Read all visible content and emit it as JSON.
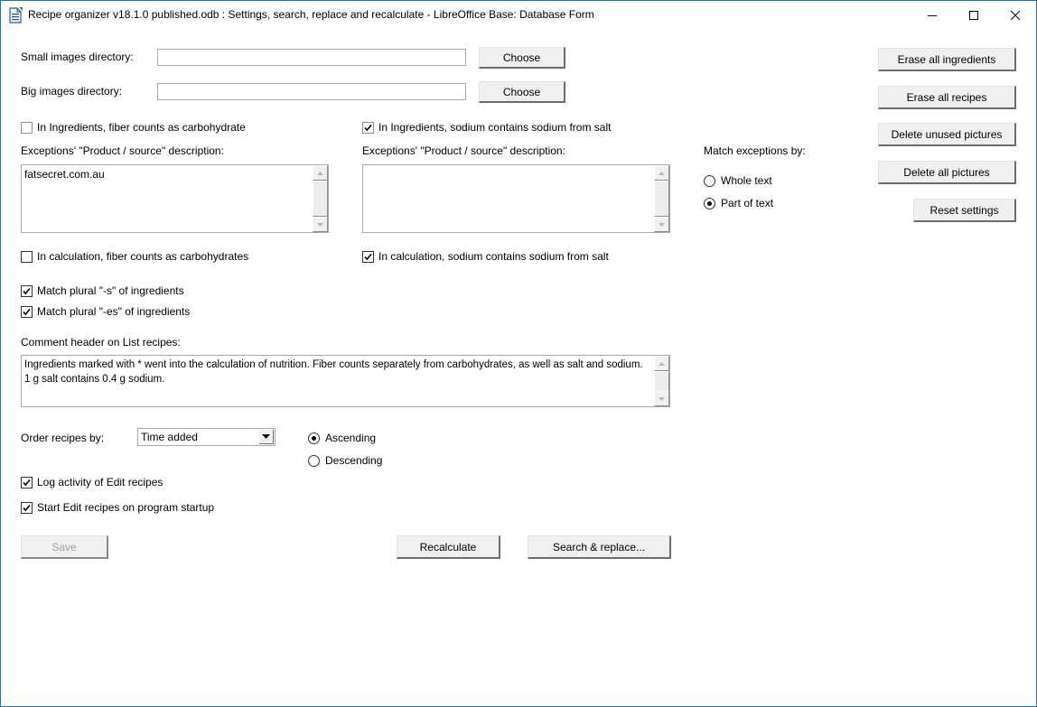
{
  "window": {
    "title": "Recipe organizer v18.1.0 published.odb : Settings, search, replace and recalculate - LibreOffice Base: Database Form",
    "app_icon": "writer-document-icon",
    "controls": {
      "minimize": "minimize-icon",
      "maximize": "maximize-icon",
      "close": "close-icon"
    }
  },
  "directories": {
    "small": {
      "label": "Small images directory:",
      "value": "",
      "button": "Choose"
    },
    "big": {
      "label": "Big images directory:",
      "value": "",
      "button": "Choose"
    }
  },
  "ingredients_options": {
    "fiber": {
      "label": "In Ingredients, fiber counts as carbohydrate",
      "checked": false
    },
    "sodium": {
      "label": "In Ingredients, sodium contains sodium from salt",
      "checked": true
    }
  },
  "exceptions": {
    "left": {
      "label": "Exceptions' \"Product / source\" description:",
      "value": "fatsecret.com.au"
    },
    "right": {
      "label": "Exceptions' \"Product / source\" description:",
      "value": ""
    },
    "match_by": {
      "label": "Match exceptions by:",
      "options": [
        {
          "label": "Whole text",
          "selected": false
        },
        {
          "label": "Part of text",
          "selected": true
        }
      ]
    }
  },
  "calculation_options": {
    "fiber": {
      "label": "In calculation, fiber counts as carbohydrates",
      "checked": false
    },
    "sodium": {
      "label": "In calculation, sodium contains sodium from salt",
      "checked": true
    }
  },
  "plural_options": {
    "s": {
      "label": "Match plural \"-s\" of ingredients",
      "checked": true
    },
    "es": {
      "label": "Match plural \"-es\" of ingredients",
      "checked": true
    }
  },
  "comment_header": {
    "label": "Comment header on List recipes:",
    "value": "Ingredients marked with * went into the calculation of nutrition. Fiber counts separately from carbohydrates, as well as salt and sodium. 1 g salt contains 0.4 g sodium."
  },
  "order": {
    "label": "Order recipes by:",
    "selected": "Time added",
    "direction": [
      {
        "label": "Ascending",
        "selected": true
      },
      {
        "label": "Descending",
        "selected": false
      }
    ]
  },
  "edit_options": {
    "log": {
      "label": "Log activity of Edit recipes",
      "checked": true
    },
    "startup": {
      "label": "Start Edit recipes on program startup",
      "checked": true
    }
  },
  "actions": {
    "save": "Save",
    "recalculate": "Recalculate",
    "search_replace": "Search & replace..."
  },
  "side_buttons": {
    "erase_ingredients": "Erase all ingredients",
    "erase_recipes": "Erase all recipes",
    "delete_unused_pictures": "Delete unused pictures",
    "delete_all_pictures": "Delete all pictures",
    "reset_settings": "Reset settings"
  },
  "colors": {
    "window_border": "#1a73b8",
    "button_face": "#f0f0f0",
    "disabled_text": "#a0a0a0"
  }
}
